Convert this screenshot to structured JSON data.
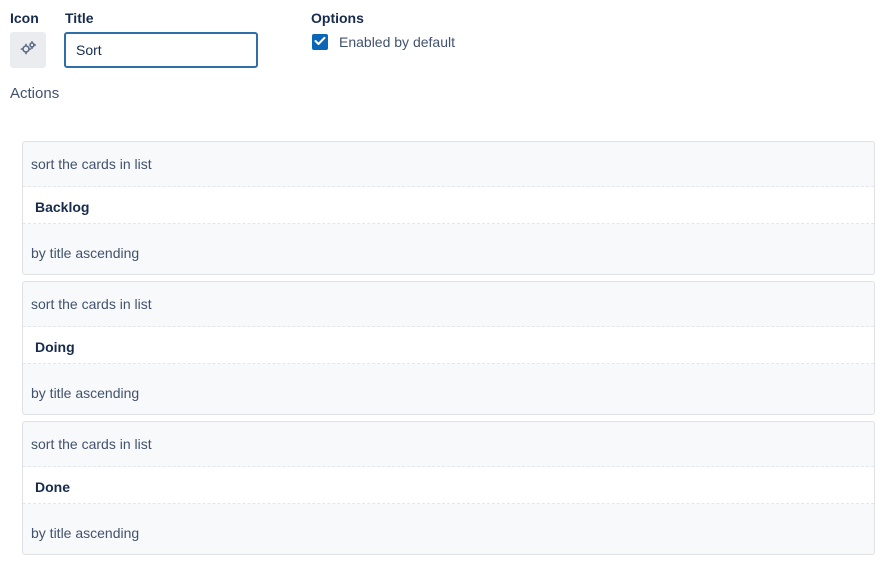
{
  "labels": {
    "icon": "Icon",
    "title": "Title",
    "options": "Options",
    "actions": "Actions"
  },
  "title_input": {
    "value": "Sort"
  },
  "options": {
    "enabled_label": "Enabled by default",
    "enabled_checked": true
  },
  "icon_button": {
    "icon": "gears-icon"
  },
  "actions": [
    {
      "prefix": "sort the cards in list",
      "list": "Backlog",
      "order": "by title ascending"
    },
    {
      "prefix": "sort the cards in list",
      "list": "Doing",
      "order": "by title ascending"
    },
    {
      "prefix": "sort the cards in list",
      "list": "Done",
      "order": "by title ascending"
    }
  ],
  "colors": {
    "accent": "#0c66b8",
    "input_border": "#2f6fa8",
    "card_bg": "#f8f9fa",
    "text_dark": "#172b4d",
    "text_muted": "#42526e"
  }
}
